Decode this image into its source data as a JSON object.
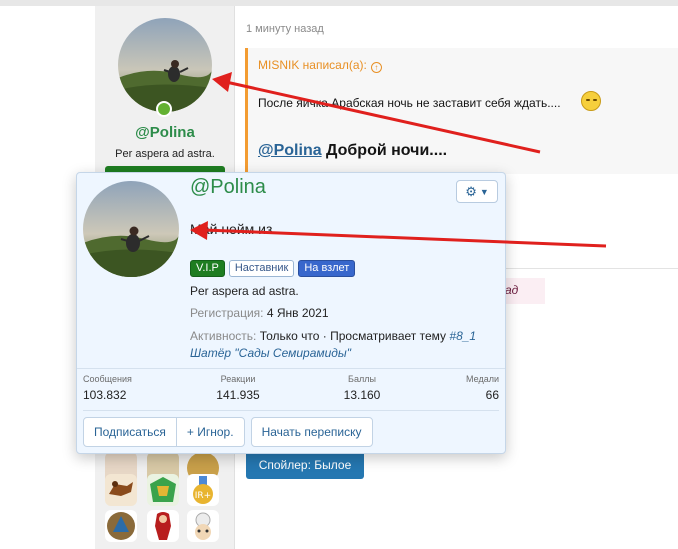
{
  "sidebar": {
    "username": "@Polina",
    "motto": "Per aspera ad astra.",
    "online": true
  },
  "post": {
    "time": "1 минуту назад",
    "quote_author": "MISNIK написал(а):",
    "quote_text": "После яичка Арабская ночь не заставит себя ждать....",
    "mention": "@Polina",
    "greeting_rest": " Доброй ночи....",
    "pink_text": "ад",
    "spoiler_label": "Спойлер: Былое"
  },
  "card": {
    "username": "@Polina",
    "status": "Май нейм из",
    "badges": [
      "V.I.P",
      "Наставник",
      "На взлет"
    ],
    "motto": "Per aspera ad astra.",
    "registration_label": "Регистрация:",
    "registration_value": "4 Янв 2021",
    "activity_label": "Активность:",
    "activity_value": "Только что · Просматривает тему",
    "activity_link": "#8_1 Шатёр \"Сады Семирамиды\"",
    "stats": [
      {
        "label": "Сообщения",
        "value": "103.832"
      },
      {
        "label": "Реакции",
        "value": "141.935"
      },
      {
        "label": "Баллы",
        "value": "13.160"
      },
      {
        "label": "Медали",
        "value": "66"
      }
    ],
    "buttons": {
      "subscribe": "Подписаться",
      "ignore": "+ Игнор.",
      "message": "Начать переписку"
    },
    "icons": {
      "settings": "gear-icon",
      "dropdown": "caret-down-icon"
    }
  },
  "colors": {
    "username_green": "#2d8c4a",
    "vip_green": "#1e7d21",
    "link_blue": "#2a6496",
    "quote_orange": "#f39c32",
    "arrow_red": "#e0201d",
    "spoiler_blue": "#2577b1"
  }
}
